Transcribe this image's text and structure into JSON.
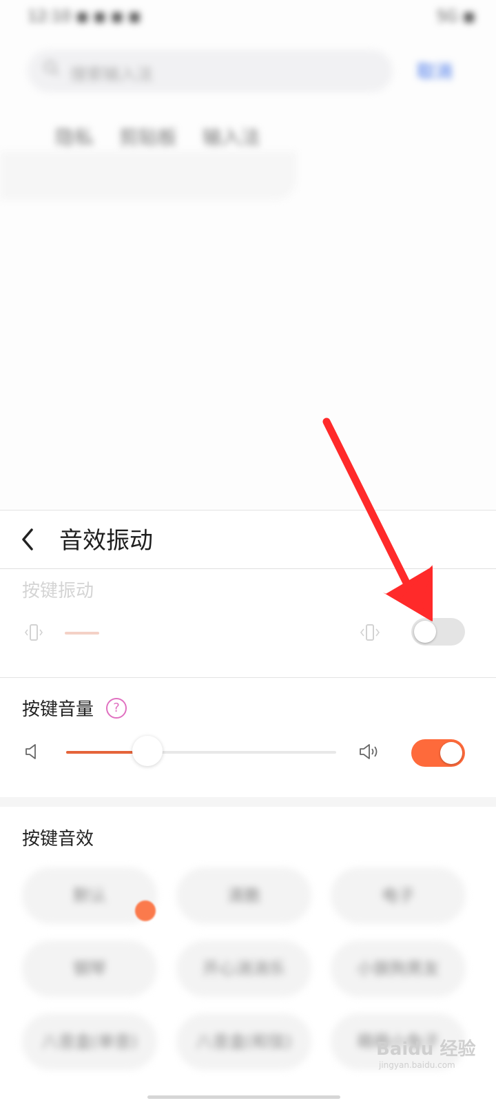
{
  "status_bar": {
    "left_text": "12:10 ◼ ◼ ◼ ◼",
    "right_text": "5G ◼"
  },
  "search": {
    "placeholder": "搜索输入法",
    "button": "取消"
  },
  "chips": [
    "隐私",
    "剪贴板",
    "输入法"
  ],
  "panel": {
    "title": "音效振动",
    "key_vibration": {
      "label": "按键振动",
      "enabled": false,
      "level": 0.12
    },
    "key_volume": {
      "label": "按键音量",
      "enabled": true,
      "level": 0.3
    },
    "key_sound": {
      "label": "按键音效",
      "options": [
        "默认",
        "清脆",
        "电子",
        "钢琴",
        "开心消消乐",
        "小狼狗男友",
        "八音盒(单音)",
        "八音盒(和弦)",
        "萌萌小兔子"
      ]
    }
  },
  "watermark": {
    "brand": "Baidu 经验",
    "url": "jingyan.baidu.com"
  },
  "colors": {
    "accent": "#fe6a3b",
    "arrow": "#ff2a2a",
    "help": "#e070c0"
  }
}
